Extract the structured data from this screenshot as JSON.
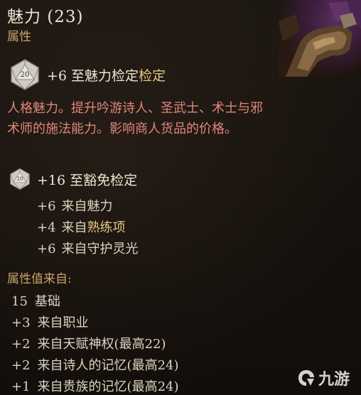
{
  "header": {
    "title": "魅力 (23)",
    "subtitle": "属性"
  },
  "ability_check": {
    "die_number": "20",
    "text_prefix": "+6  至魅力检定",
    "text_highlight": "检定"
  },
  "description": "人格魅力。提升吟游诗人、圣武士、术士与邪术师的施法能力。影响商人货品的价格。",
  "saving_throw": {
    "die_number": "20",
    "text": "+16 至豁免检定",
    "bonuses": [
      {
        "value": "+6",
        "source": "来自魅力",
        "highlight": ""
      },
      {
        "value": "+4",
        "source": "来自",
        "highlight": "熟练项"
      },
      {
        "value": "+6",
        "source": "来自守护灵光",
        "highlight": ""
      }
    ]
  },
  "attribute_sources": {
    "heading": "属性值来自:",
    "rows": [
      {
        "value": "15",
        "source": "基础"
      },
      {
        "value": "+3",
        "source": "来自职业"
      },
      {
        "value": "+2",
        "source": "来自天赋神权(最高22)"
      },
      {
        "value": "+2",
        "source": "来自诗人的记忆(最高24)"
      },
      {
        "value": "+1",
        "source": "来自贵族的记忆(最高24)"
      }
    ]
  },
  "watermark": {
    "text": "九游"
  },
  "colors": {
    "background": "#17120e",
    "title": "#efe4d2",
    "gold": "#c8a467",
    "highlight": "#e6c583",
    "description": "#e0867a",
    "body": "#dfd3c0"
  },
  "icons": {
    "check_die": "d20-die-icon",
    "save_die": "d20-die-icon",
    "watermark_logo": "jiuyou-logo-icon"
  }
}
